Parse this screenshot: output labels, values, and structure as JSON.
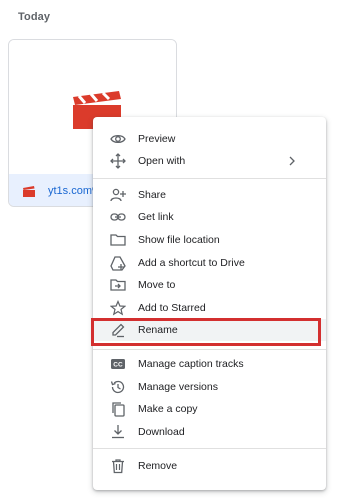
{
  "section": {
    "label": "Today"
  },
  "file": {
    "name": "yt1s.com%",
    "icon": "video-clapper-icon"
  },
  "menu": {
    "items": [
      {
        "label": "Preview",
        "icon": "eye-icon"
      },
      {
        "label": "Open with",
        "icon": "move-arrows-icon",
        "submenu": true
      },
      {
        "label": "Share",
        "icon": "person-add-icon"
      },
      {
        "label": "Get link",
        "icon": "link-icon"
      },
      {
        "label": "Show file location",
        "icon": "folder-icon"
      },
      {
        "label": "Add a shortcut to Drive",
        "icon": "drive-shortcut-icon"
      },
      {
        "label": "Move to",
        "icon": "move-to-folder-icon"
      },
      {
        "label": "Add to Starred",
        "icon": "star-icon"
      },
      {
        "label": "Rename",
        "icon": "pencil-icon",
        "highlighted": true
      },
      {
        "label": "Manage caption tracks",
        "icon": "closed-captions-icon"
      },
      {
        "label": "Manage versions",
        "icon": "history-icon"
      },
      {
        "label": "Make a copy",
        "icon": "copy-icon"
      },
      {
        "label": "Download",
        "icon": "download-icon"
      },
      {
        "label": "Remove",
        "icon": "trash-icon"
      }
    ]
  },
  "colors": {
    "accent_red": "#db3b2b",
    "highlight_border": "#d32f2f",
    "link_blue": "#1967d2"
  }
}
